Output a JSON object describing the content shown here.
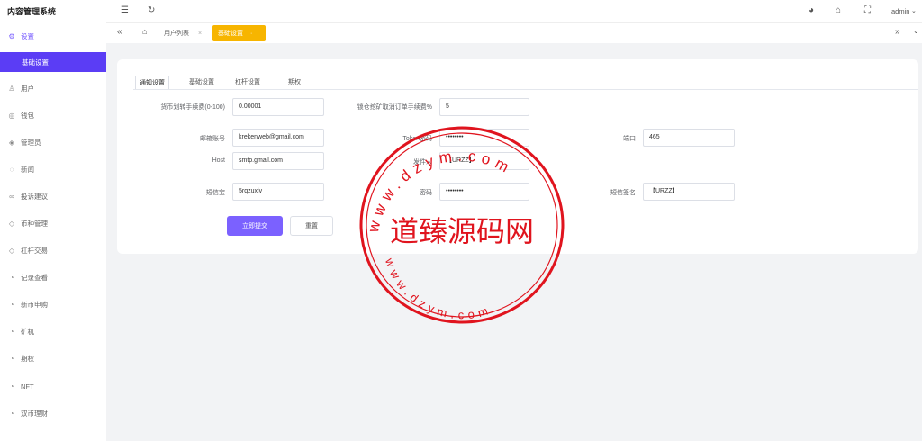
{
  "sidebar": {
    "brand": "内容管理系统",
    "settings_label": "设置",
    "active_sub": "基础设置",
    "items": [
      {
        "label": "用户",
        "icon": "user-icon"
      },
      {
        "label": "钱包",
        "icon": "wallet-icon"
      },
      {
        "label": "管理员",
        "icon": "admin-icon"
      },
      {
        "label": "新闻",
        "icon": "news-icon"
      },
      {
        "label": "投诉建议",
        "icon": "feedback-icon"
      },
      {
        "label": "币种管理",
        "icon": "coin-icon"
      },
      {
        "label": "杠杆交易",
        "icon": "lever-icon"
      },
      {
        "label": "记录查看",
        "icon": "record-icon"
      },
      {
        "label": "新币申购",
        "icon": "subscribe-icon"
      },
      {
        "label": "矿机",
        "icon": "miner-icon"
      },
      {
        "label": "期权",
        "icon": "option-icon"
      },
      {
        "label": "NFT",
        "icon": "nft-icon"
      },
      {
        "label": "双币理财",
        "icon": "finance-icon"
      }
    ]
  },
  "header": {
    "user": "admin"
  },
  "tabs": {
    "home_icon": "home-icon",
    "items": [
      {
        "label": "用户列表"
      },
      {
        "label": "基础设置"
      }
    ]
  },
  "form": {
    "tabs": [
      "通知设置",
      "基础设置",
      "杠杆设置",
      "期权"
    ],
    "fields": {
      "coin_fee_label": "货币划转手续费(0-100)",
      "coin_fee_value": "0.00001",
      "mining_fee_label": "锁仓挖矿取消订单手续费%",
      "mining_fee_value": "5",
      "email_label": "邮箱账号",
      "email_value": "krekenweb@gmail.com",
      "token_label": "Token密码",
      "token_value": "••••••••",
      "port_label": "端口",
      "port_value": "465",
      "host_label": "Host",
      "host_value": "smtp.gmail.com",
      "sender_label": "发件人",
      "sender_value": "【URZZ】",
      "sms_label": "短信宝",
      "sms_value": "5rqzuxlv",
      "password_label": "密码",
      "password_value": "••••••••",
      "sms_sign_label": "短信签名",
      "sms_sign_value": "【URZZ】"
    },
    "submit_label": "立即提交",
    "reset_label": "重置"
  },
  "watermark": {
    "title": "道臻源码网",
    "top_text": "www.dzym.com",
    "bottom_text": "www.dzym.com"
  },
  "colors": {
    "accent": "#5b3df5",
    "primary_button": "#7b61ff",
    "active_tab": "#f7b500",
    "stamp": "#e0141e"
  }
}
